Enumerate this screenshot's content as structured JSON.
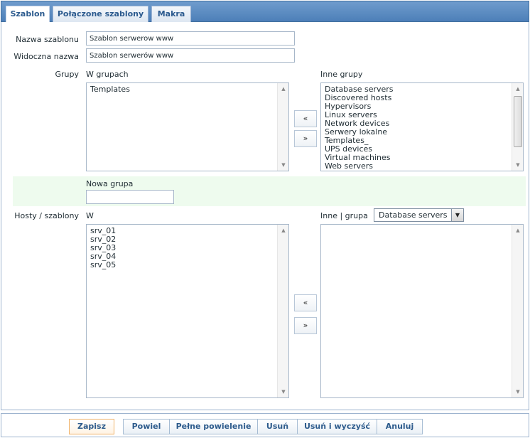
{
  "tabs": [
    {
      "label": "Szablon"
    },
    {
      "label": "Połączone szablony"
    },
    {
      "label": "Makra"
    }
  ],
  "form": {
    "template_name_label": "Nazwa szablonu",
    "template_name_value": "Szablon serwerow www",
    "visible_name_label": "Widoczna nazwa",
    "visible_name_value": "Szablon serwerów www",
    "groups_label": "Grupy",
    "in_groups_label": "W grupach",
    "other_groups_label": "Inne grupy",
    "in_groups": [
      "Templates"
    ],
    "other_groups": [
      "Database servers",
      "Discovered hosts",
      "Hypervisors",
      "Linux servers",
      "Network devices",
      "Serwery lokalne",
      "Templates_",
      "UPS devices",
      "Virtual machines",
      "Web servers"
    ],
    "new_group_label": "Nowa grupa",
    "new_group_value": "",
    "hosts_label": "Hosty / szablony",
    "hosts_in_label": "W",
    "hosts_other_label": "Inne | grupa",
    "group_select_value": "Database servers",
    "hosts_in": [
      "srv_01",
      "srv_02",
      "srv_03",
      "srv_04",
      "srv_05"
    ],
    "move_left": "«",
    "move_right": "»"
  },
  "footer": {
    "save": "Zapisz",
    "clone": "Powiel",
    "full_clone": "Pełne powielenie",
    "delete": "Usuń",
    "delete_clear": "Usuń i wyczyść",
    "cancel": "Anuluj"
  },
  "icons": {
    "scroll_up": "up-arrow-icon",
    "scroll_down": "down-arrow-icon",
    "dropdown": "dropdown-arrow-icon"
  },
  "colors": {
    "tabbar": "#5a88c0",
    "new_group_row": "#eefbee",
    "save_border": "#f0b36a"
  }
}
